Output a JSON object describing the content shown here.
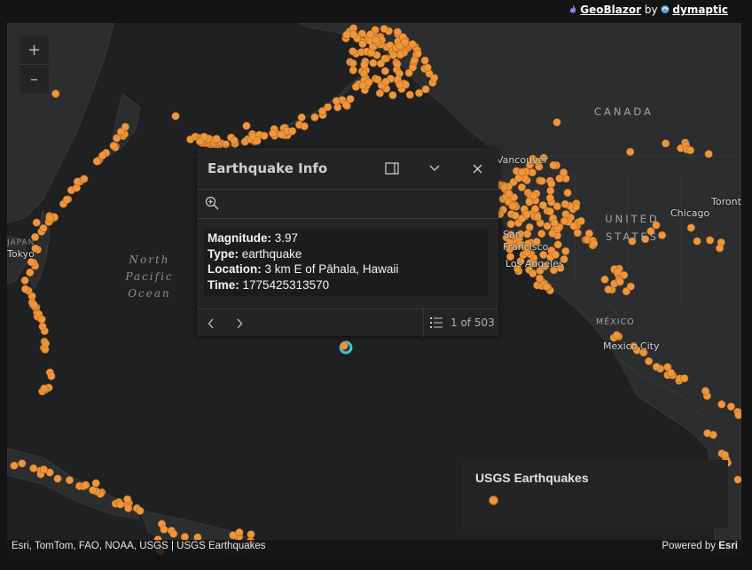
{
  "credit": {
    "product": "GeoBlazor",
    "by": "by",
    "company": "dymaptic"
  },
  "map": {
    "zoom_in": "+",
    "zoom_out": "–",
    "labels": {
      "canada": "CANADA",
      "united_states": "UNITED STATES",
      "mexico": "MÉXICO",
      "japan": "JAPAN",
      "ocean": "North Pacific Ocean",
      "vancouver": "Vancouver",
      "san_francisco": "San Francisco",
      "los_angeles": "Los Angeles",
      "chicago": "Chicago",
      "toronto": "Toronto",
      "mexico_city": "Mexico City",
      "tokyo": "Tokyo"
    },
    "point_color": "#f0963a",
    "selected_color": "#47c1d8"
  },
  "popup": {
    "title": "Earthquake Info",
    "fields": [
      {
        "label": "Magnitude:",
        "value": "3.97"
      },
      {
        "label": "Type:",
        "value": "earthquake"
      },
      {
        "label": "Location:",
        "value": "3 km E of Pāhala, Hawaii"
      },
      {
        "label": "Time:",
        "value": "1775425313570"
      }
    ],
    "pager": "1 of 503",
    "icons": {
      "dock": "dock-icon",
      "collapse": "chevron-down-icon",
      "close": "close-icon",
      "zoom_to": "zoom-in-icon",
      "previous": "chevron-left-icon",
      "next": "chevron-right-icon",
      "list": "list-icon"
    }
  },
  "legend": {
    "title": "USGS Earthquakes"
  },
  "attribution": {
    "sources": "Esri, TomTom, FAO, NOAA, USGS | USGS Earthquakes",
    "powered_prefix": "Powered by",
    "powered_brand": "Esri"
  }
}
